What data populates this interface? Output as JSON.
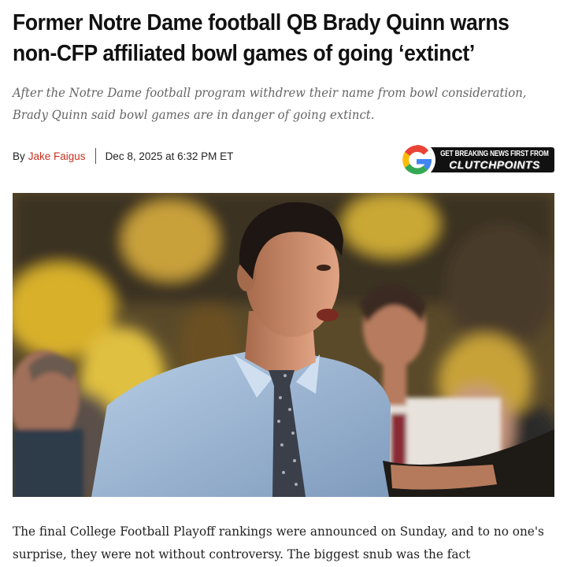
{
  "article": {
    "headline": "Former Notre Dame football QB Brady Quinn warns non-CFP affiliated bowl games of going ‘extinct’",
    "subheading": "After the Notre Dame football program withdrew their name from bowl consideration, Brady Quinn said bowl games are in danger of going extinct.",
    "byline": {
      "prefix": "By",
      "author": "Jake Faigus",
      "date": "Dec 8, 2025 at 6:32 PM ET"
    },
    "promo": {
      "icon": "google-g-icon",
      "top_text": "GET BREAKING NEWS FIRST FROM",
      "brand_text": "CLUTCHPOINTS"
    },
    "body_first_paragraph": "The final College Football Playoff rankings were announced on Sunday, and to no one's surprise, they were not without controversy. The biggest snub was the fact"
  },
  "colors": {
    "author_link": "#c8301e",
    "subheading": "#666666",
    "promo_banner": "#111111"
  }
}
